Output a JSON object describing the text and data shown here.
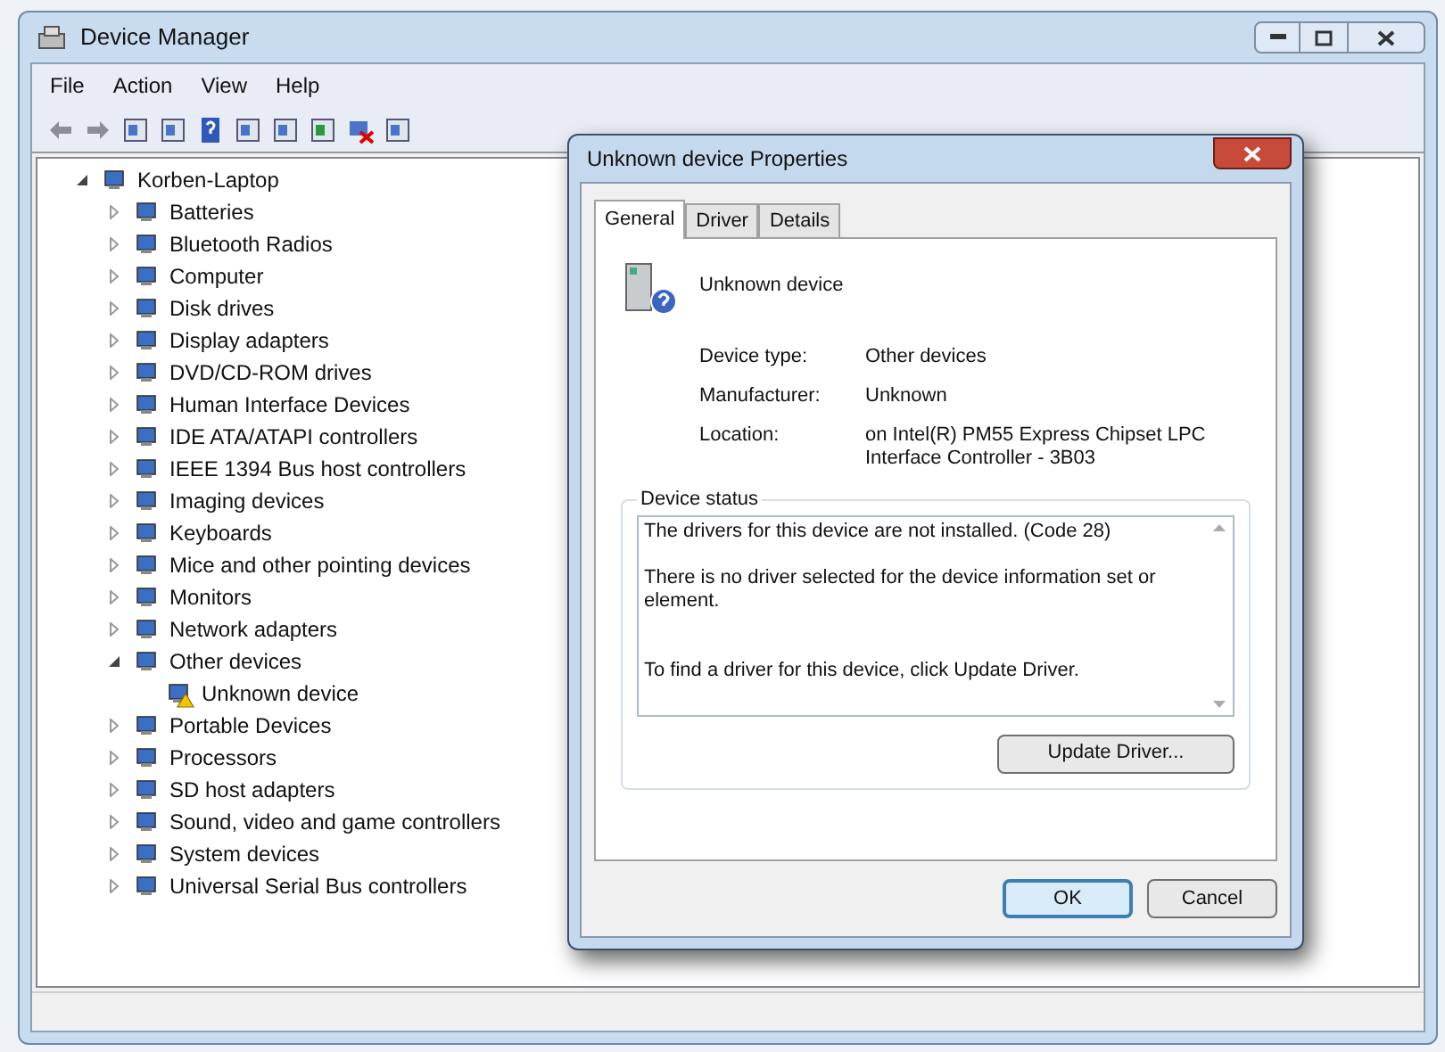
{
  "window": {
    "title": "Device Manager"
  },
  "menu": [
    "File",
    "Action",
    "View",
    "Help"
  ],
  "tree": {
    "label": "Korben-Laptop",
    "expanded": true,
    "children": [
      {
        "label": "Batteries",
        "expanded": false
      },
      {
        "label": "Bluetooth Radios",
        "expanded": false
      },
      {
        "label": "Computer",
        "expanded": false
      },
      {
        "label": "Disk drives",
        "expanded": false
      },
      {
        "label": "Display adapters",
        "expanded": false
      },
      {
        "label": "DVD/CD-ROM drives",
        "expanded": false
      },
      {
        "label": "Human Interface Devices",
        "expanded": false
      },
      {
        "label": "IDE ATA/ATAPI controllers",
        "expanded": false
      },
      {
        "label": "IEEE 1394 Bus host controllers",
        "expanded": false
      },
      {
        "label": "Imaging devices",
        "expanded": false
      },
      {
        "label": "Keyboards",
        "expanded": false
      },
      {
        "label": "Mice and other pointing devices",
        "expanded": false
      },
      {
        "label": "Monitors",
        "expanded": false
      },
      {
        "label": "Network adapters",
        "expanded": false
      },
      {
        "label": "Other devices",
        "expanded": true,
        "children": [
          {
            "label": "Unknown device",
            "warning": true
          }
        ]
      },
      {
        "label": "Portable Devices",
        "expanded": false
      },
      {
        "label": "Processors",
        "expanded": false
      },
      {
        "label": "SD host adapters",
        "expanded": false
      },
      {
        "label": "Sound, video and game controllers",
        "expanded": false
      },
      {
        "label": "System devices",
        "expanded": false
      },
      {
        "label": "Universal Serial Bus controllers",
        "expanded": false
      }
    ]
  },
  "dialog": {
    "title": "Unknown device Properties",
    "tabs": [
      {
        "label": "General",
        "selected": true
      },
      {
        "label": "Driver",
        "selected": false
      },
      {
        "label": "Details",
        "selected": false
      }
    ],
    "device_name": "Unknown device",
    "properties": [
      {
        "label": "Device type:",
        "value": "Other devices"
      },
      {
        "label": "Manufacturer:",
        "value": "Unknown"
      },
      {
        "label": "Location:",
        "value": "on Intel(R) PM55 Express Chipset LPC Interface Controller - 3B03"
      }
    ],
    "status_title": "Device status",
    "status_lines": [
      "The drivers for this device are not installed. (Code 28)",
      "There is no driver selected for the device information set or element.",
      "To find a driver for this device, click Update Driver."
    ],
    "update_button": "Update Driver...",
    "buttons": [
      {
        "label": "OK",
        "default": true
      },
      {
        "label": "Cancel",
        "default": false
      }
    ]
  }
}
